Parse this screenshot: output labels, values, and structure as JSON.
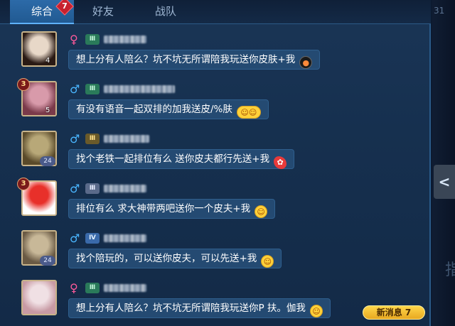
{
  "tabs": [
    {
      "label": "综合",
      "active": true,
      "badge": "7"
    },
    {
      "label": "好友",
      "active": false
    },
    {
      "label": "战队",
      "active": false
    }
  ],
  "corner_number": "31",
  "expand_button_glyph": "<",
  "edge_glyph": "指",
  "messages": [
    {
      "gender": "♀",
      "gender_type": "female",
      "rank_icon": "Ⅲ",
      "rank_color": "green",
      "avatar_number": "4",
      "avatar_badge": "",
      "level": "",
      "avatar_colors": [
        "#e8d8c8",
        "#2a1a14"
      ],
      "text": "想上分有人陪么？坑不坑无所谓陪我玩送你皮肤+我",
      "emoji": "bomb-emoji",
      "emoji_glyph": "●"
    },
    {
      "gender": "♂",
      "gender_type": "male",
      "rank_icon": "Ⅲ",
      "rank_color": "green",
      "avatar_number": "5",
      "avatar_badge": "",
      "level": "3",
      "avatar_colors": [
        "#d89aaa",
        "#7a3a4a"
      ],
      "text": "有没有语音一起双排的加我送皮/%肤",
      "emoji": "smile-emoji",
      "emoji_glyph": "☺☺"
    },
    {
      "gender": "♂",
      "gender_type": "male",
      "rank_icon": "Ⅲ",
      "rank_color": "gold",
      "avatar_number": "",
      "avatar_badge": "24",
      "level": "",
      "avatar_colors": [
        "#b8a878",
        "#5a4a2a"
      ],
      "text": "找个老铁一起排位有么 送你皮夫都行先送+我",
      "emoji": "rose-emoji",
      "emoji_glyph": "✿"
    },
    {
      "gender": "♂",
      "gender_type": "male",
      "rank_icon": "Ⅲ",
      "rank_color": "silver",
      "avatar_number": "",
      "avatar_badge": "",
      "level": "3",
      "avatar_colors": [
        "#e8302a",
        "#ffffff"
      ],
      "text": "排位有么 求大神带两吧送你一个皮夫+我",
      "emoji": "smirk-emoji",
      "emoji_glyph": "☺"
    },
    {
      "gender": "♂",
      "gender_type": "male",
      "rank_icon": "Ⅳ",
      "rank_color": "blue",
      "avatar_number": "",
      "avatar_badge": "24",
      "level": "",
      "avatar_colors": [
        "#c8b898",
        "#6a5a44"
      ],
      "text": "找个陪玩的，可以送你皮夫，可以先送+我",
      "emoji": "smirk-emoji",
      "emoji_glyph": "☺"
    },
    {
      "gender": "♀",
      "gender_type": "female",
      "rank_icon": "Ⅲ",
      "rank_color": "green",
      "avatar_number": "",
      "avatar_badge": "",
      "level": "",
      "avatar_colors": [
        "#f0e0e4",
        "#c89aa4"
      ],
      "text": "想上分有人陪么？坑不坑无所谓陪我玩送你P 扶。伽我",
      "emoji": "thinking-emoji",
      "emoji_glyph": "☺"
    }
  ],
  "new_messages": {
    "label": "新消息",
    "count": "7"
  }
}
